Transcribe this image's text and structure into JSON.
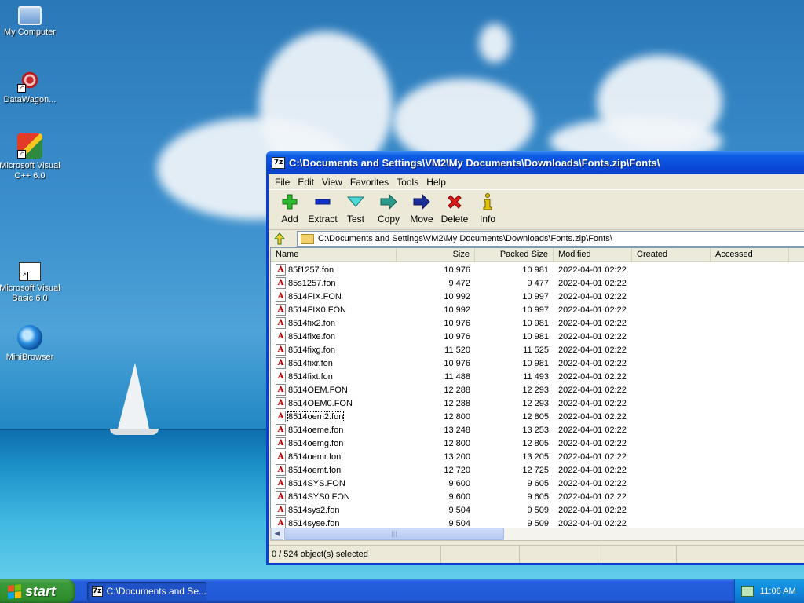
{
  "desktop": {
    "icons": [
      {
        "label": "My Computer",
        "icon": "computer-icon"
      },
      {
        "label": "DataWagon...",
        "icon": "datawagon-icon"
      },
      {
        "label": "Microsoft Visual C++ 6.0",
        "icon": "visual-cpp-icon"
      },
      {
        "label": "Microsoft Visual Basic 6.0",
        "icon": "visual-basic-icon"
      },
      {
        "label": "MiniBrowser",
        "icon": "minibrowser-icon"
      }
    ]
  },
  "window": {
    "app_badge": "7z",
    "title": "C:\\Documents and Settings\\VM2\\My Documents\\Downloads\\Fonts.zip\\Fonts\\",
    "menu": [
      "File",
      "Edit",
      "View",
      "Favorites",
      "Tools",
      "Help"
    ],
    "toolbar": [
      {
        "label": "Add",
        "icon": "plus-icon"
      },
      {
        "label": "Extract",
        "icon": "minus-icon"
      },
      {
        "label": "Test",
        "icon": "check-icon"
      },
      {
        "label": "Copy",
        "icon": "copy-arrow-icon"
      },
      {
        "label": "Move",
        "icon": "move-arrow-icon"
      },
      {
        "label": "Delete",
        "icon": "delete-x-icon"
      },
      {
        "label": "Info",
        "icon": "info-icon"
      }
    ],
    "address": "C:\\Documents and Settings\\VM2\\My Documents\\Downloads\\Fonts.zip\\Fonts\\",
    "columns": [
      "Name",
      "Size",
      "Packed Size",
      "Modified",
      "Created",
      "Accessed"
    ],
    "files": [
      {
        "name": "85f1257.fon",
        "size": "10 976",
        "packed": "10 981",
        "modified": "2022-04-01 02:22"
      },
      {
        "name": "85s1257.fon",
        "size": "9 472",
        "packed": "9 477",
        "modified": "2022-04-01 02:22"
      },
      {
        "name": "8514FIX.FON",
        "size": "10 992",
        "packed": "10 997",
        "modified": "2022-04-01 02:22"
      },
      {
        "name": "8514FIX0.FON",
        "size": "10 992",
        "packed": "10 997",
        "modified": "2022-04-01 02:22"
      },
      {
        "name": "8514fix2.fon",
        "size": "10 976",
        "packed": "10 981",
        "modified": "2022-04-01 02:22"
      },
      {
        "name": "8514fixe.fon",
        "size": "10 976",
        "packed": "10 981",
        "modified": "2022-04-01 02:22"
      },
      {
        "name": "8514fixg.fon",
        "size": "11 520",
        "packed": "11 525",
        "modified": "2022-04-01 02:22"
      },
      {
        "name": "8514fixr.fon",
        "size": "10 976",
        "packed": "10 981",
        "modified": "2022-04-01 02:22"
      },
      {
        "name": "8514fixt.fon",
        "size": "11 488",
        "packed": "11 493",
        "modified": "2022-04-01 02:22"
      },
      {
        "name": "8514OEM.FON",
        "size": "12 288",
        "packed": "12 293",
        "modified": "2022-04-01 02:22"
      },
      {
        "name": "8514OEM0.FON",
        "size": "12 288",
        "packed": "12 293",
        "modified": "2022-04-01 02:22"
      },
      {
        "name": "8514oem2.fon",
        "size": "12 800",
        "packed": "12 805",
        "modified": "2022-04-01 02:22",
        "focused": true
      },
      {
        "name": "8514oeme.fon",
        "size": "13 248",
        "packed": "13 253",
        "modified": "2022-04-01 02:22"
      },
      {
        "name": "8514oemg.fon",
        "size": "12 800",
        "packed": "12 805",
        "modified": "2022-04-01 02:22"
      },
      {
        "name": "8514oemr.fon",
        "size": "13 200",
        "packed": "13 205",
        "modified": "2022-04-01 02:22"
      },
      {
        "name": "8514oemt.fon",
        "size": "12 720",
        "packed": "12 725",
        "modified": "2022-04-01 02:22"
      },
      {
        "name": "8514SYS.FON",
        "size": "9 600",
        "packed": "9 605",
        "modified": "2022-04-01 02:22"
      },
      {
        "name": "8514SYS0.FON",
        "size": "9 600",
        "packed": "9 605",
        "modified": "2022-04-01 02:22"
      },
      {
        "name": "8514sys2.fon",
        "size": "9 504",
        "packed": "9 509",
        "modified": "2022-04-01 02:22"
      },
      {
        "name": "8514syse.fon",
        "size": "9 504",
        "packed": "9 509",
        "modified": "2022-04-01 02:22"
      }
    ],
    "status": "0 / 524 object(s) selected"
  },
  "taskbar": {
    "start_label": "start",
    "task_badge": "7z",
    "task_label": "C:\\Documents and Se...",
    "clock": "11:06 AM"
  },
  "colors": {
    "titlebar": "#0a48d8",
    "window_bg": "#ece9d8",
    "start_green": "#3c9a3a",
    "taskbar_blue": "#245edb"
  }
}
